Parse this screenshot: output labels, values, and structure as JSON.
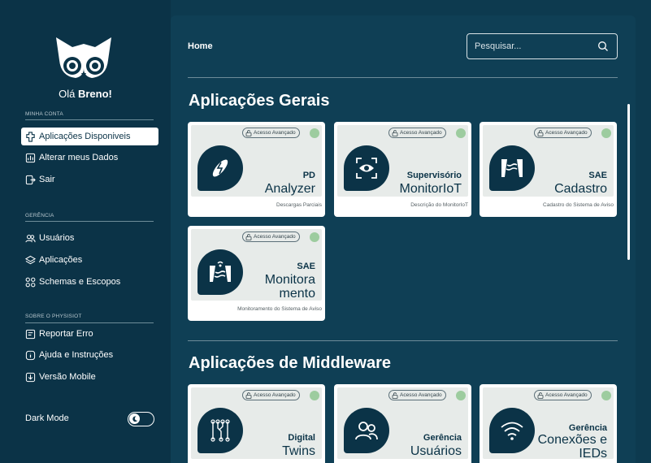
{
  "user": {
    "greeting_prefix": "Olá",
    "name": "Breno!"
  },
  "sidebar": {
    "sections": [
      {
        "title": "MINHA CONTA",
        "items": [
          {
            "label": "Aplicações Disponiveis",
            "icon": "puzzle-icon",
            "active": true
          },
          {
            "label": "Alterar meus Dados",
            "icon": "chart-icon",
            "active": false
          },
          {
            "label": "Sair",
            "icon": "logout-icon",
            "active": false
          }
        ]
      },
      {
        "title": "GERÊNCIA",
        "items": [
          {
            "label": "Usuários",
            "icon": "users-icon",
            "active": false
          },
          {
            "label": "Aplicações",
            "icon": "layers-icon",
            "active": false
          },
          {
            "label": "Schemas e Escopos",
            "icon": "grid-icon",
            "active": false
          }
        ]
      },
      {
        "title": "SOBRE O PHYSISIOT",
        "items": [
          {
            "label": "Reportar Erro",
            "icon": "report-icon",
            "active": false
          },
          {
            "label": "Ajuda e Instruções",
            "icon": "info-icon",
            "active": false
          },
          {
            "label": "Versão Mobile",
            "icon": "download-icon",
            "active": false
          }
        ]
      }
    ],
    "dark_mode_label": "Dark Mode"
  },
  "header": {
    "breadcrumb": "Home",
    "search_placeholder": "Pesquisar..."
  },
  "sections": [
    {
      "title_light": "Aplicações",
      "title_bold": "Gerais",
      "cards": [
        {
          "badge": "Acesso Avançado",
          "title": "PD",
          "subtitle": [
            "Analyzer"
          ],
          "description": "Descargas Parciais",
          "icon": "discharge-icon"
        },
        {
          "badge": "Acesso Avançado",
          "title": "Supervisório",
          "subtitle": [
            "MonitorIoT"
          ],
          "description": "Descrição do MonitorIoT",
          "icon": "eye-scan-icon"
        },
        {
          "badge": "Acesso Avançado",
          "title": "SAE",
          "subtitle": [
            "Cadastro"
          ],
          "description": "Cadastro do Sistema de Aviso",
          "icon": "dam-icon"
        },
        {
          "badge": "Acesso Avançado",
          "title": "SAE",
          "subtitle": [
            "Monitora",
            "mento"
          ],
          "description": "Monitoramento do Sistema de Aviso",
          "icon": "dam-monitor-icon"
        }
      ]
    },
    {
      "title_light": "Aplicações de",
      "title_bold": "Middleware",
      "cards": [
        {
          "badge": "Acesso Avançado",
          "title": "Digital",
          "subtitle": [
            "Twins"
          ],
          "description": "",
          "icon": "circuit-icon"
        },
        {
          "badge": "Acesso Avançado",
          "title": "Gerência",
          "subtitle": [
            "Usuários"
          ],
          "description": "",
          "icon": "users-icon"
        },
        {
          "badge": "Acesso Avançado",
          "title": "Gerência",
          "subtitle": [
            "Conexões e",
            "IEDs"
          ],
          "description": "",
          "icon": "wifi-icon"
        }
      ]
    }
  ],
  "colors": {
    "background": "#0d3a4f",
    "sidebar": "#0b3347",
    "card_dot": "#9dcc9f",
    "card_icon_bg": "#0b3347"
  }
}
